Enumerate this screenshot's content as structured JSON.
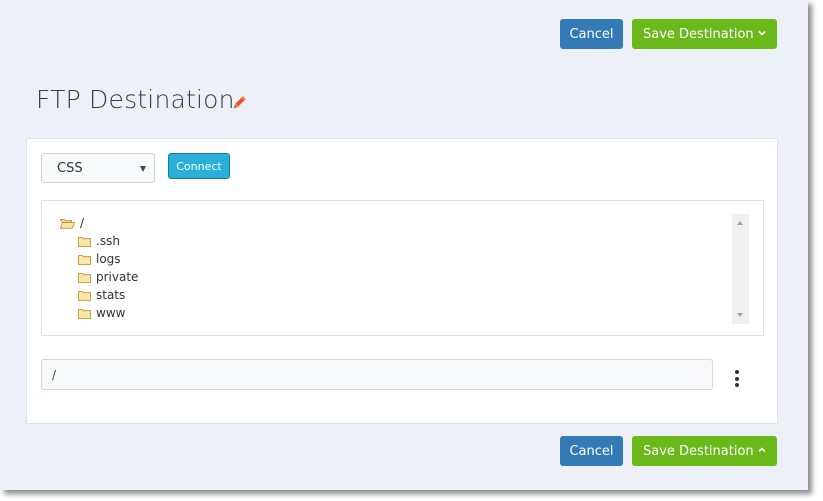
{
  "header": {
    "cancel_label": "Cancel",
    "save_label": "Save Destination",
    "save_caret": "chevron-down-icon"
  },
  "page": {
    "title": "FTP Destination",
    "edit_icon": "pencil-icon"
  },
  "connection": {
    "selected_profile": "CSS",
    "connect_label": "Connect"
  },
  "tree": {
    "root": {
      "label": "/",
      "icon": "folder-open-icon"
    },
    "children": [
      {
        "label": ".ssh",
        "icon": "folder-icon"
      },
      {
        "label": "logs",
        "icon": "folder-icon"
      },
      {
        "label": "private",
        "icon": "folder-icon"
      },
      {
        "label": "stats",
        "icon": "folder-icon"
      },
      {
        "label": "www",
        "icon": "folder-icon"
      }
    ]
  },
  "path": {
    "value": "/"
  },
  "footer": {
    "cancel_label": "Cancel",
    "save_label": "Save Destination",
    "save_caret": "chevron-up-icon"
  },
  "colors": {
    "primary": "#337ab7",
    "success": "#6ab819",
    "info": "#2ab0d8",
    "edit_icon": "#e8542a",
    "background": "#edf1f7"
  }
}
